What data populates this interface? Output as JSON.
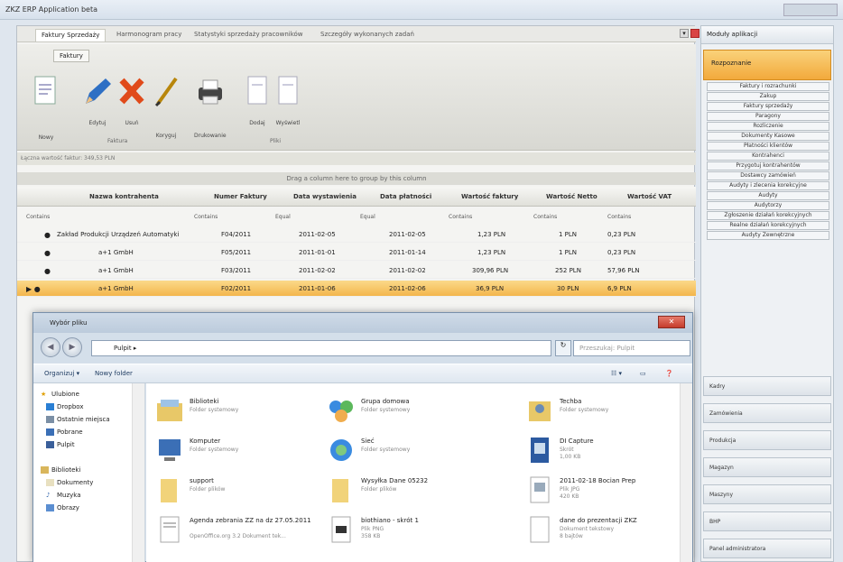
{
  "window": {
    "title": "ZKZ ERP Application beta"
  },
  "tabs": [
    {
      "label": "Faktury Sprzedaży",
      "active": true
    },
    {
      "label": "Harmonogram pracy"
    },
    {
      "label": "Statystyki sprzedaży pracowników"
    },
    {
      "label": "Szczegóły wykonanych zadań"
    }
  ],
  "ribbon": {
    "tab": "Faktury",
    "buttons": {
      "nowy": "Nowy",
      "edytuj": "Edytuj",
      "usun": "Usuń",
      "koryguj": "Koryguj",
      "drukowanie": "Drukowanie",
      "dodaj": "Dodaj",
      "wyslij": "Wyświetl"
    },
    "groups": {
      "faktura": "Faktura",
      "pliki": "Pliki"
    }
  },
  "summary": "Łączna wartość faktur: 349,53 PLN",
  "group_bar": "Drag a column here to group by this column",
  "grid": {
    "columns": [
      "Nazwa kontrahenta",
      "Numer Faktury",
      "Data wystawienia",
      "Data płatności",
      "Wartość faktury",
      "Wartość Netto",
      "Wartość VAT"
    ],
    "filters": [
      "Contains",
      "Contains",
      "Equal",
      "Equal",
      "Contains",
      "Contains",
      "Contains"
    ],
    "rows": [
      {
        "name": "Zakład Produkcji Urządzeń Automatyki",
        "num": "F04/2011",
        "issued": "2011-02-05",
        "due": "2011-02-05",
        "value": "1,23 PLN",
        "net": "1 PLN",
        "vat": "0,23 PLN",
        "selected": false
      },
      {
        "name": "a+1 GmbH",
        "num": "F05/2011",
        "issued": "2011-01-01",
        "due": "2011-01-14",
        "value": "1,23 PLN",
        "net": "1 PLN",
        "vat": "0,23 PLN",
        "selected": false
      },
      {
        "name": "a+1 GmbH",
        "num": "F03/2011",
        "issued": "2011-02-02",
        "due": "2011-02-02",
        "value": "309,96 PLN",
        "net": "252 PLN",
        "vat": "57,96 PLN",
        "selected": false
      },
      {
        "name": "a+1 GmbH",
        "num": "F02/2011",
        "issued": "2011-01-06",
        "due": "2011-02-06",
        "value": "36,9 PLN",
        "net": "30 PLN",
        "vat": "6,9 PLN",
        "selected": true
      }
    ]
  },
  "dialog": {
    "title": "Wybór pliku",
    "address": "Pulpit",
    "search_placeholder": "Przeszukaj: Pulpit",
    "organize": "Organizuj ▾",
    "new_folder": "Nowy folder",
    "nav": [
      "Ulubione",
      "Dropbox",
      "Ostatnie miejsca",
      "Pobrane",
      "Pulpit",
      "Biblioteki",
      "Dokumenty",
      "Muzyka",
      "Obrazy"
    ],
    "items": [
      {
        "name": "Biblioteki",
        "sub": "Folder systemowy",
        "sub2": ""
      },
      {
        "name": "Grupa domowa",
        "sub": "Folder systemowy",
        "sub2": ""
      },
      {
        "name": "Techba",
        "sub": "Folder systemowy",
        "sub2": ""
      },
      {
        "name": "Komputer",
        "sub": "Folder systemowy",
        "sub2": ""
      },
      {
        "name": "Sieć",
        "sub": "Folder systemowy",
        "sub2": ""
      },
      {
        "name": "DI Capture",
        "sub": "Skrót",
        "sub2": "1,00 KB"
      },
      {
        "name": "support",
        "sub": "Folder plików",
        "sub2": ""
      },
      {
        "name": "Wysyłka Dane 05232",
        "sub": "Folder plików",
        "sub2": ""
      },
      {
        "name": "2011-02-18 Bocian Prep",
        "sub": "Plik JPG",
        "sub2": "420 KB"
      },
      {
        "name": "Agenda zebrania ZZ na dz 27.05.2011",
        "sub": "OpenOffice.org 3.2 Dokument tek...",
        "sub2": ""
      },
      {
        "name": "biothiano - skrót 1",
        "sub": "Plik PNG",
        "sub2": "358 KB"
      },
      {
        "name": "dane do prezentacji ZKZ",
        "sub": "Dokument tekstowy",
        "sub2": "8 bajtów"
      }
    ]
  },
  "right_panel": {
    "title": "Moduły aplikacji",
    "active": "Rozpoznanie",
    "items": [
      "Faktury i rozrachunki",
      "Zakup",
      "Faktury sprzedaży",
      "Paragony",
      "Rozliczenie",
      "Dokumenty Kasowe",
      "Płatności klientów",
      "Kontrahenci",
      "Przygotuj kontrahentów",
      "Dostawcy zamówień",
      "Audyty i zlecenia korekcyjne",
      "Audyty",
      "Audytorzy",
      "Zgłoszenie działań korekcyjnych",
      "Realne działań korekcyjnych",
      "Audyty Zewnętrzne"
    ],
    "categories": [
      "Kadry",
      "Zamówienia",
      "Produkcja",
      "Magazyn",
      "Maszyny",
      "BHP",
      "Panel administratora"
    ]
  }
}
